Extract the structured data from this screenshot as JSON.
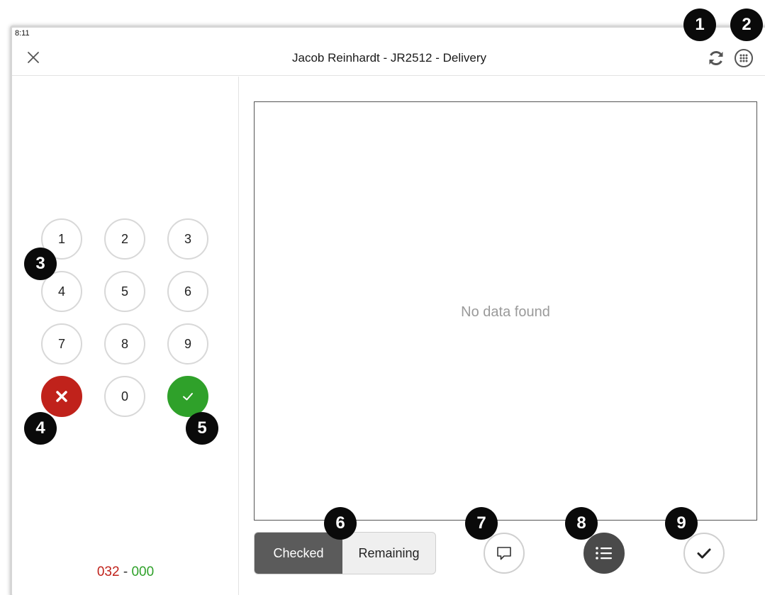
{
  "status_bar": {
    "time": "8:11"
  },
  "header": {
    "title": "Jacob Reinhardt - JR2512 - Delivery",
    "close_icon": "close-icon",
    "refresh_icon": "refresh-icon",
    "keypad_icon": "keypad-icon"
  },
  "keypad": {
    "keys": [
      "1",
      "2",
      "3",
      "4",
      "5",
      "6",
      "7",
      "8",
      "9",
      "0"
    ],
    "cancel_icon": "x-icon",
    "confirm_icon": "checkmark-icon"
  },
  "counter": {
    "checked": "032",
    "separator": "-",
    "remaining": "000"
  },
  "main": {
    "empty_message": "No data found"
  },
  "segment": {
    "checked_label": "Checked",
    "remaining_label": "Remaining",
    "selected": "Checked"
  },
  "actions": {
    "comment_icon": "comment-icon",
    "list_icon": "list-icon",
    "done_icon": "checkmark-icon"
  },
  "markers": [
    "1",
    "2",
    "3",
    "4",
    "5",
    "6",
    "7",
    "8",
    "9"
  ],
  "colors": {
    "cancel": "#c0221b",
    "confirm": "#2fa12a",
    "segment_active": "#5b5b5b",
    "marker": "#0a0a0a"
  }
}
